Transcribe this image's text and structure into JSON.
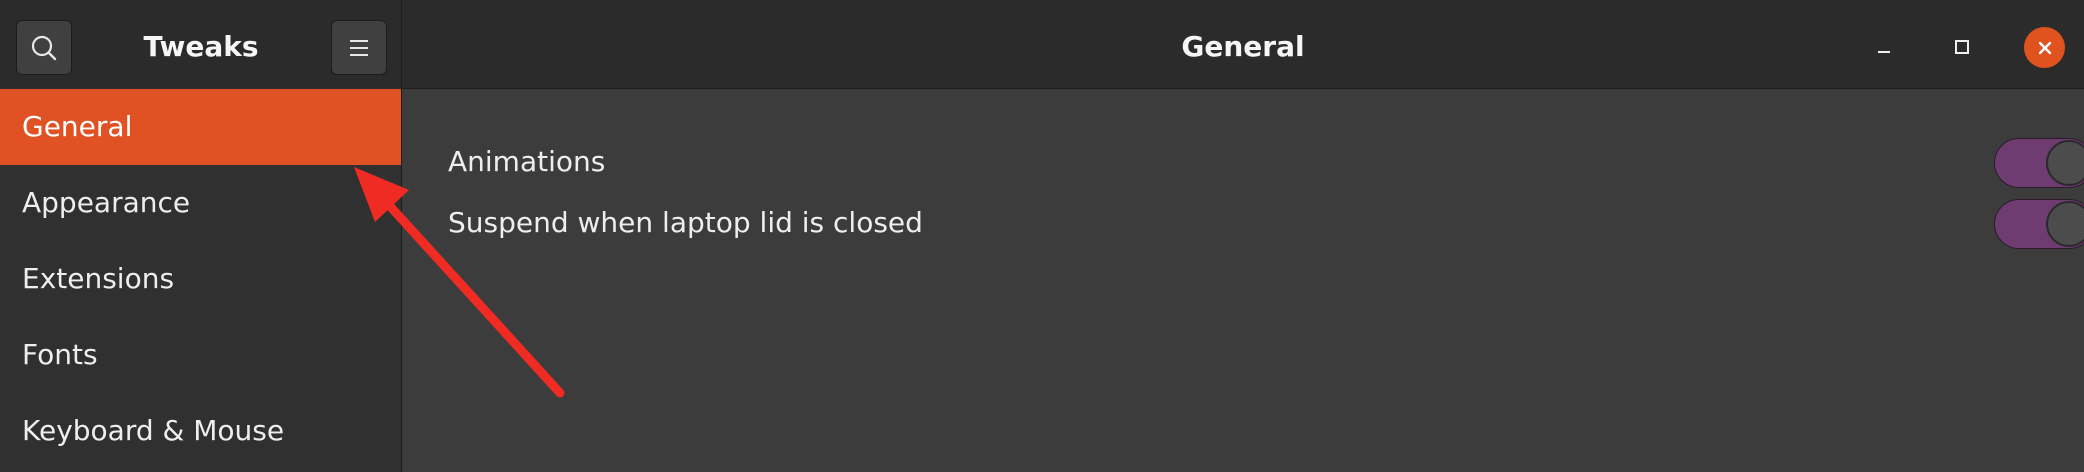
{
  "header": {
    "sidebar_title": "Tweaks",
    "main_title": "General",
    "search_icon": "search-icon",
    "menu_icon": "hamburger-menu-icon",
    "minimize_icon": "minimize-icon",
    "maximize_icon": "maximize-icon",
    "close_icon": "close-icon"
  },
  "sidebar": {
    "items": [
      {
        "label": "General",
        "active": true
      },
      {
        "label": "Appearance",
        "active": false
      },
      {
        "label": "Extensions",
        "active": false
      },
      {
        "label": "Fonts",
        "active": false
      },
      {
        "label": "Keyboard & Mouse",
        "active": false
      }
    ]
  },
  "settings": [
    {
      "label": "Animations",
      "enabled": true
    },
    {
      "label": "Suspend when laptop lid is closed",
      "enabled": true
    }
  ],
  "colors": {
    "accent": "#e05223",
    "switch_on": "#6e3c70",
    "annotation_arrow": "#ef2b24"
  }
}
